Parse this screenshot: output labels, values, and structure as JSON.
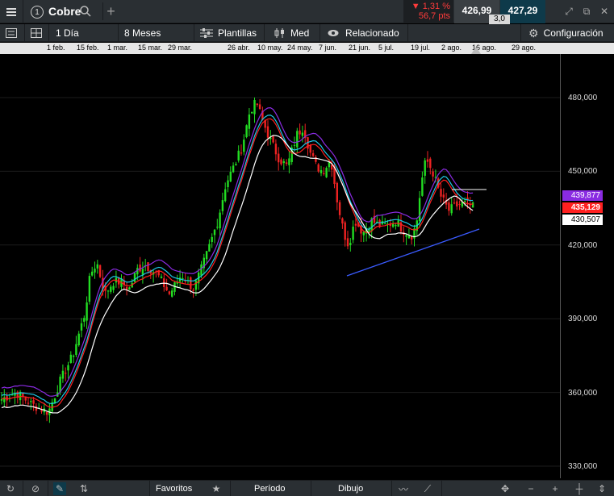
{
  "topbar": {
    "instrument_number": "1",
    "symbol": "Cobre",
    "change_pct": "▼ 1,31 %",
    "change_pts": "56,7 pts",
    "sell_price": "426,99",
    "buy_price": "427,29",
    "spread": "3,0"
  },
  "toolbar": {
    "interval": "1 Día",
    "range": "8 Meses",
    "templates": "Plantillas",
    "price_type": "Med",
    "related": "Relacionado",
    "settings": "Configuración"
  },
  "time_axis": [
    "1 feb.",
    "15 feb.",
    "1 mar.",
    "15 mar.",
    "29 mar.",
    "26 abr.",
    "10 may.",
    "24 may.",
    "7 jun.",
    "21 jun.",
    "5 jul.",
    "19 jul.",
    "2 ago.",
    "16 ago.",
    "29 ago."
  ],
  "chart_data": {
    "type": "candlestick",
    "y_ticks": [
      "480,000",
      "450,000",
      "420,000",
      "390,000",
      "360,000",
      "330,000"
    ],
    "ylim": [
      327,
      497
    ],
    "price_tags": [
      {
        "value": "439,877",
        "color": "#8a2be2"
      },
      {
        "value": "435,129",
        "color": "#ff2020"
      },
      {
        "value": "430,507",
        "color": "#ffffff"
      }
    ],
    "colors": {
      "up": "#22dd22",
      "down": "#ee2222",
      "trendline": "#3a5bff",
      "ma_purple": "#8a2be2",
      "ma_red": "#ff2020",
      "ma_cyan": "#1ec8e6",
      "ma_white": "#ffffff"
    }
  },
  "bottombar": {
    "favorites": "Favoritos",
    "period": "Período",
    "drawing": "Dibujo"
  }
}
